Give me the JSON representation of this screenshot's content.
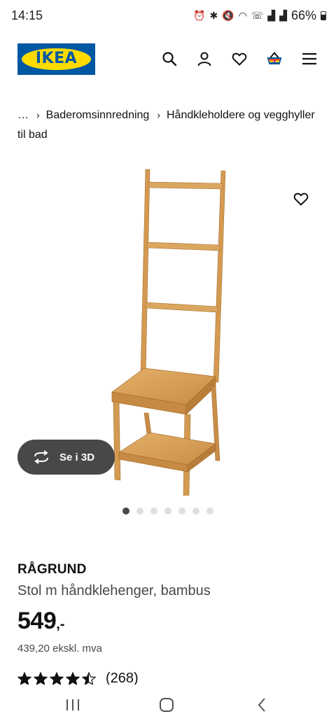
{
  "status_bar": {
    "time": "14:15",
    "battery_label": "66%",
    "icons": [
      "alarm-icon",
      "bluetooth-icon",
      "mute-icon",
      "wifi-icon",
      "wifi-call-icon",
      "signal-icon",
      "signal-icon",
      "battery-icon"
    ]
  },
  "header": {
    "logo_text": "IKEA",
    "icons": [
      "search-icon",
      "account-icon",
      "heart-icon",
      "basket-icon",
      "menu-icon"
    ]
  },
  "breadcrumb": {
    "items": [
      "…",
      "Baderomsinnredning",
      "Håndkleholdere og vegghyller til bad"
    ]
  },
  "gallery": {
    "see_3d_label": "Se i 3D",
    "image_count": 7,
    "active_index": 0
  },
  "product": {
    "name": "RÅGRUND",
    "description": "Stol m håndklehenger, bambus",
    "price": "549",
    "price_suffix": ",-",
    "price_ex_vat": "439,20 ekskl. mva",
    "rating": 4.5,
    "rating_max": 5,
    "review_count": "(268)"
  },
  "colors": {
    "ikea_blue": "#0058a3",
    "ikea_yellow": "#ffdb00",
    "button_dark": "#484848",
    "wood": "#d9a25c"
  }
}
